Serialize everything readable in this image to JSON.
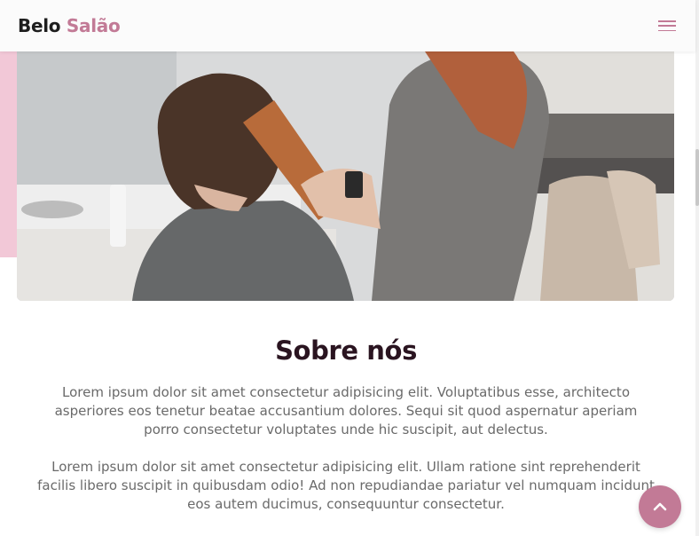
{
  "header": {
    "brand_part1": "Belo",
    "brand_part2": "Salão",
    "menu_icon": "hamburger-icon"
  },
  "hero": {
    "image_subject": "hairdresser brushing a client's hair in a salon"
  },
  "about": {
    "title": "Sobre nós",
    "paragraphs": [
      "Lorem ipsum dolor sit amet consectetur adipisicing elit. Voluptatibus esse, architecto asperiores eos tenetur beatae accusantium dolores. Sequi sit quod aspernatur aperiam porro consectetur voluptates unde hic suscipit, aut delectus.",
      "Lorem ipsum dolor sit amet consectetur adipisicing elit. Ullam ratione sint reprehenderit facilis libero suscipit in quibusdam odio! Ad non repudiandae pariatur vel numquam incidunt eos autem ducimus, consequuntur consectetur."
    ]
  },
  "back_to_top": {
    "icon": "chevron-up-icon"
  },
  "colors": {
    "accent": "#c27a96",
    "accent_light": "#f2c8d7",
    "heading": "#2a1420",
    "text": "#6a6a6a"
  }
}
